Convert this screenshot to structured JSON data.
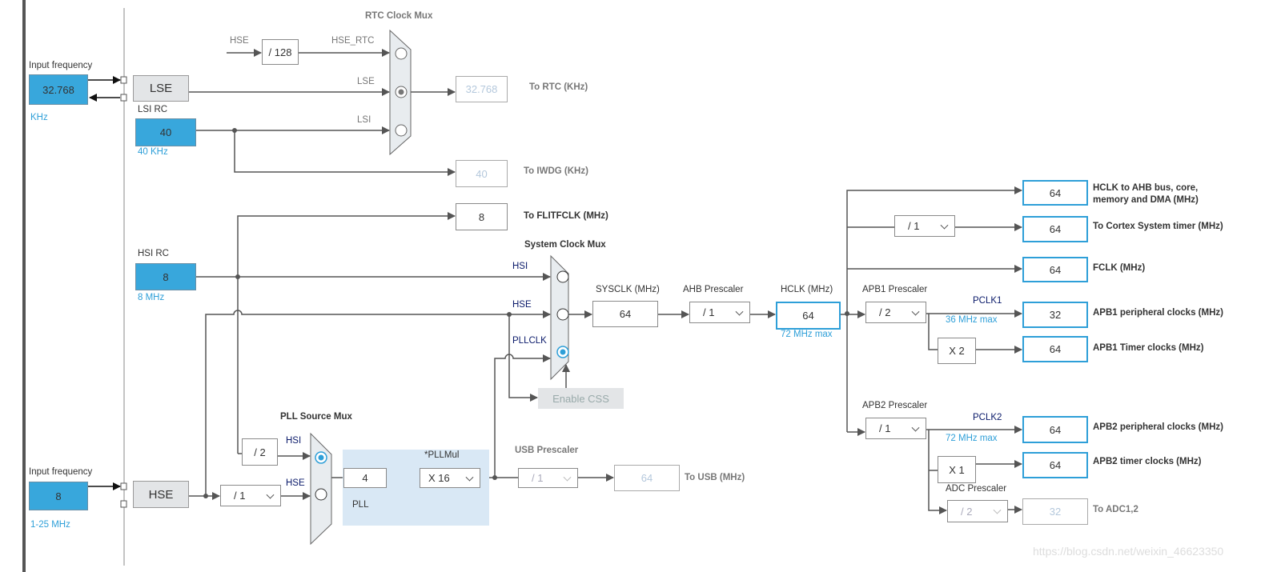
{
  "colors": {
    "accent": "#2e9fd8",
    "input_fill": "#38a7dc",
    "wire": "#555555",
    "pll_area": "#d9e8f5"
  },
  "lse_input": {
    "label": "Input frequency",
    "value": "32.768",
    "unit": "KHz"
  },
  "lse": {
    "label": "LSE"
  },
  "lsi": {
    "label": "LSI RC",
    "value": "40",
    "note": "40 KHz"
  },
  "rtc_mux": {
    "title": "RTC Clock Mux",
    "hse_label": "HSE",
    "divider": "/ 128",
    "hse_rtc_label": "HSE_RTC",
    "lse_label": "LSE",
    "lsi_label": "LSI",
    "selected": "LSE"
  },
  "rtc_out": {
    "value": "32.768",
    "label": "To RTC (KHz)"
  },
  "iwdg_out": {
    "value": "40",
    "label": "To IWDG (KHz)"
  },
  "flit_out": {
    "value": "8",
    "label": "To FLITFCLK (MHz)"
  },
  "hsi": {
    "label": "HSI RC",
    "value": "8",
    "note": "8 MHz"
  },
  "sys_mux": {
    "title": "System Clock Mux",
    "hsi_label": "HSI",
    "hse_label": "HSE",
    "pll_label": "PLLCLK",
    "selected": "PLLCLK",
    "css_button": "Enable CSS"
  },
  "sysclk": {
    "label": "SYSCLK (MHz)",
    "value": "64"
  },
  "ahb": {
    "label": "AHB Prescaler",
    "value": "/ 1"
  },
  "hclk": {
    "label": "HCLK (MHz)",
    "value": "64",
    "max": "72 MHz max"
  },
  "outputs": {
    "ahb": {
      "value": "64",
      "label": "HCLK to AHB bus, core, memory and DMA (MHz)"
    },
    "cortex": {
      "prescaler": "/ 1",
      "value": "64",
      "label": "To Cortex System timer (MHz)"
    },
    "fclk": {
      "value": "64",
      "label": "FCLK (MHz)"
    }
  },
  "apb1": {
    "label": "APB1 Prescaler",
    "value": "/ 2",
    "pclk": "PCLK1",
    "max": "36 MHz max",
    "periph_value": "32",
    "periph_label": "APB1 peripheral clocks (MHz)",
    "timer_mult": "X 2",
    "timer_value": "64",
    "timer_label": "APB1 Timer clocks (MHz)"
  },
  "apb2": {
    "label": "APB2 Prescaler",
    "value": "/ 1",
    "pclk": "PCLK2",
    "max": "72 MHz max",
    "periph_value": "64",
    "periph_label": "APB2 peripheral clocks (MHz)",
    "timer_mult": "X 1",
    "timer_value": "64",
    "timer_label": "APB2 timer clocks (MHz)"
  },
  "adc": {
    "label": "ADC Prescaler",
    "value": "/ 2",
    "out_value": "32",
    "out_label": "To ADC1,2"
  },
  "hse_input": {
    "label": "Input frequency",
    "value": "8",
    "range": "1-25 MHz"
  },
  "hse": {
    "label": "HSE",
    "prediv": "/ 1"
  },
  "pll_mux": {
    "title": "PLL Source Mux",
    "hsi_div": "/ 2",
    "hsi_label": "HSI",
    "hse_label": "HSE",
    "selected": "HSI"
  },
  "pll": {
    "label": "PLL",
    "input_value": "4",
    "mul_label": "*PLLMul",
    "mul_value": "X 16"
  },
  "usb": {
    "label": "USB Prescaler",
    "value": "/ 1",
    "out_value": "64",
    "out_label": "To USB (MHz)"
  },
  "watermark": "https://blog.csdn.net/weixin_46623350"
}
